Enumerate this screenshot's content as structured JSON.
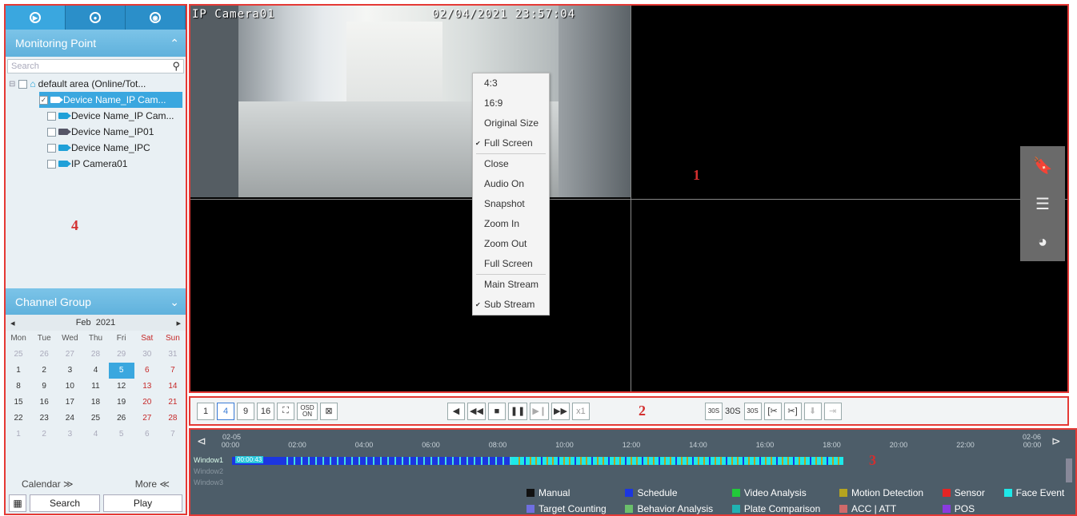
{
  "left_panel": {
    "monitoring_point": "Monitoring Point",
    "search_placeholder": "Search",
    "tree": [
      {
        "label": "default area (Online/Tot..."
      },
      {
        "label": "Device Name_IP Cam..."
      },
      {
        "label": "Device Name_IP Cam..."
      },
      {
        "label": "Device Name_IP01"
      },
      {
        "label": "Device Name_IPC"
      },
      {
        "label": "IP Camera01"
      }
    ],
    "channel_group": "Channel Group",
    "region_label": "4",
    "calendar": {
      "month": "Feb",
      "year": "2021",
      "weekdays": [
        "Mon",
        "Tue",
        "Wed",
        "Thu",
        "Fri",
        "Sat",
        "Sun"
      ],
      "days": [
        "25",
        "26",
        "27",
        "28",
        "29",
        "30",
        "31",
        "1",
        "2",
        "3",
        "4",
        "5",
        "6",
        "7",
        "8",
        "9",
        "10",
        "11",
        "12",
        "13",
        "14",
        "15",
        "16",
        "17",
        "18",
        "19",
        "20",
        "21",
        "22",
        "23",
        "24",
        "25",
        "26",
        "27",
        "28",
        "1",
        "2",
        "3",
        "4",
        "5",
        "6",
        "7"
      ]
    },
    "calendar_toggle": "Calendar ≫",
    "more_toggle": "More ≪",
    "search_button": "Search",
    "play_button": "Play"
  },
  "video": {
    "camera_name": "IP Camera01",
    "timestamp": "02/04/2021 23:57:04",
    "region_label": "1",
    "context_menu": [
      "4:3",
      "16:9",
      "Original Size",
      "Full Screen",
      "Close",
      "Audio On",
      "Snapshot",
      "Zoom In",
      "Zoom Out",
      "Full Screen",
      "Main Stream",
      "Sub Stream"
    ]
  },
  "toolbar": {
    "region_label": "2",
    "layouts": [
      "1",
      "4",
      "9",
      "16"
    ],
    "osd": "OSD ON",
    "speed": "x1",
    "back30": "30S",
    "skip_label": "30S",
    "fwd30": "30S"
  },
  "timeline": {
    "region_label": "3",
    "start_date": "02-05",
    "end_date": "02-06",
    "ticks": [
      "00:00",
      "02:00",
      "04:00",
      "06:00",
      "08:00",
      "10:00",
      "12:00",
      "14:00",
      "16:00",
      "18:00",
      "20:00",
      "22:00",
      "00:00"
    ],
    "windows": [
      "Window1",
      "Window2",
      "Window3"
    ],
    "window1_badge": "00:00:43",
    "legend": [
      {
        "label": "Manual",
        "color": "#111111"
      },
      {
        "label": "Schedule",
        "color": "#1c36e0"
      },
      {
        "label": "Video Analysis",
        "color": "#22c93a"
      },
      {
        "label": "Motion Detection",
        "color": "#b5a420"
      },
      {
        "label": "Sensor",
        "color": "#e52424"
      },
      {
        "label": "Face Event",
        "color": "#1ee8e8"
      },
      {
        "label": "Target Counting",
        "color": "#6f6fe0"
      },
      {
        "label": "Behavior Analysis",
        "color": "#6bbf6b"
      },
      {
        "label": "Plate Comparison",
        "color": "#1fb3b3"
      },
      {
        "label": "ACC | ATT",
        "color": "#d06a6a"
      },
      {
        "label": "POS",
        "color": "#8a3be0"
      }
    ]
  }
}
